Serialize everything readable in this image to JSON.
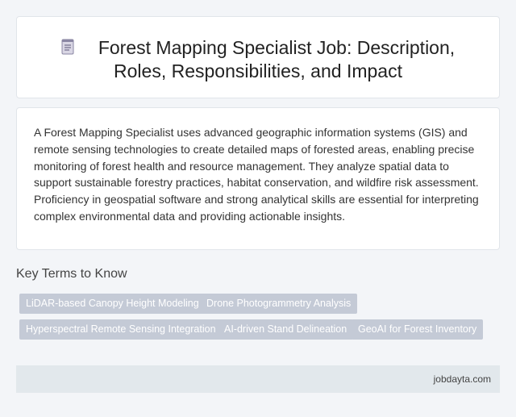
{
  "header": {
    "icon": "document-icon",
    "title_line1": "Forest Mapping Specialist Job: Description,",
    "title_line2": "Roles, Responsibilities, and Impact"
  },
  "description": "A Forest Mapping Specialist uses advanced geographic information systems (GIS) and remote sensing technologies to create detailed maps of forested areas, enabling precise monitoring of forest health and resource management. They analyze spatial data to support sustainable forestry practices, habitat conservation, and wildfire risk assessment. Proficiency in geospatial software and strong analytical skills are essential for interpreting complex environmental data and providing actionable insights.",
  "key_terms": {
    "heading": "Key Terms to Know",
    "tags": [
      "LiDAR-based Canopy Height Modeling",
      "Drone Photogrammetry Analysis",
      "Hyperspectral Remote Sensing Integration",
      "AI-driven Stand Delineation",
      "GeoAI for Forest Inventory"
    ]
  },
  "footer": {
    "site": "jobdayta.com"
  },
  "colors": {
    "background": "#f3f5f8",
    "tag_background": "#c4cad6",
    "footer_background": "#e2e8ec"
  }
}
